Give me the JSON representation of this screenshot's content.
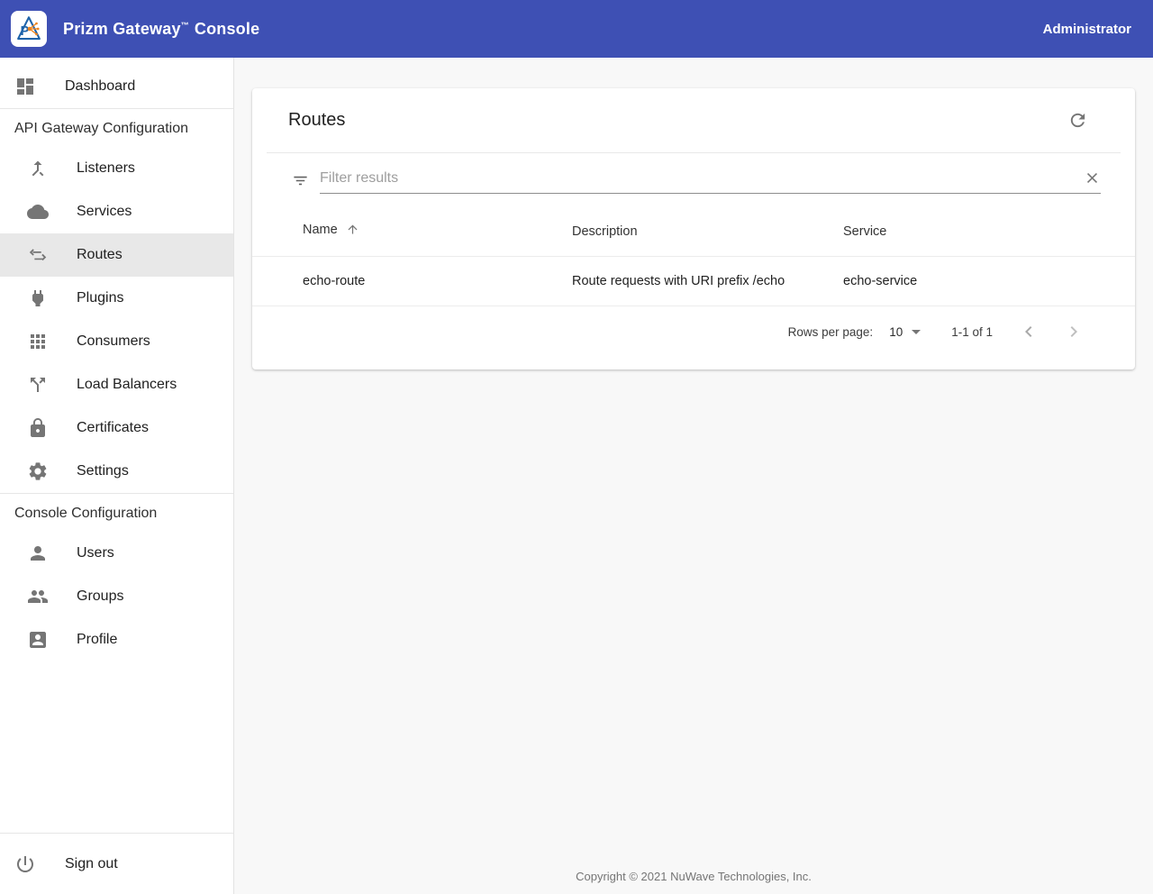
{
  "colors": {
    "header_bg": "#3e50b4",
    "header_text": "#ffffff",
    "selected_item_bg": "#e8e8e8",
    "icon_grey": "#757575",
    "logo_blue": "#1e63a9",
    "logo_orange": "#f0861f"
  },
  "header": {
    "title": "Prizm Gateway",
    "trademark": "™",
    "title_suffix": "Console",
    "user": "Administrator"
  },
  "sidebar": {
    "dashboard_label": "Dashboard",
    "section1": {
      "title": "API Gateway Configuration",
      "items": [
        {
          "label": "Listeners",
          "icon": "merge-icon",
          "selected": false
        },
        {
          "label": "Services",
          "icon": "cloud-icon",
          "selected": false
        },
        {
          "label": "Routes",
          "icon": "swap-arrows-icon",
          "selected": true
        },
        {
          "label": "Plugins",
          "icon": "plug-icon",
          "selected": false
        },
        {
          "label": "Consumers",
          "icon": "apps-grid-icon",
          "selected": false
        },
        {
          "label": "Load Balancers",
          "icon": "call-split-icon",
          "selected": false
        },
        {
          "label": "Certificates",
          "icon": "lock-icon",
          "selected": false
        },
        {
          "label": "Settings",
          "icon": "gear-icon",
          "selected": false
        }
      ]
    },
    "section2": {
      "title": "Console Configuration",
      "items": [
        {
          "label": "Users",
          "icon": "person-icon"
        },
        {
          "label": "Groups",
          "icon": "people-icon"
        },
        {
          "label": "Profile",
          "icon": "contact-card-icon"
        }
      ]
    },
    "signout_label": "Sign out"
  },
  "main": {
    "card": {
      "title": "Routes",
      "filter_placeholder": "Filter results",
      "table": {
        "columns": [
          "Name",
          "Description",
          "Service"
        ],
        "sorted_column": "Name",
        "sort_direction": "asc",
        "rows": [
          [
            "echo-route",
            "Route requests with URI prefix /echo",
            "echo-service"
          ]
        ]
      },
      "pagination": {
        "rows_per_page_label": "Rows per page:",
        "rows_per_page_value": "10",
        "range_label": "1-1 of 1"
      }
    },
    "footer": "Copyright © 2021 NuWave Technologies, Inc."
  }
}
